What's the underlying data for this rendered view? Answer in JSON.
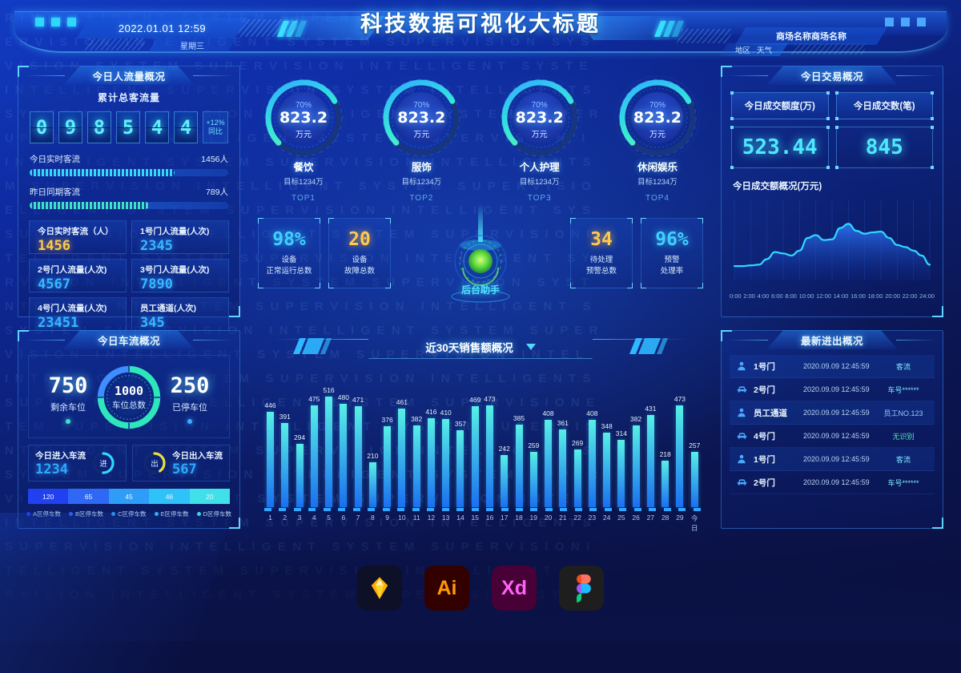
{
  "header": {
    "title": "科技数据可视化大标题",
    "datetime": "2022.01.01 12:59",
    "weekday": "星期三",
    "mall_name": "商场名称商场名称",
    "region_weather": "地区 . 天气"
  },
  "flow_panel": {
    "title": "今日人流量概况",
    "counter_label": "累计总客流量",
    "counter_digits": [
      "0",
      "9",
      "8",
      "5",
      "4",
      "4"
    ],
    "compare_value": "+12%",
    "compare_label": "同比",
    "bars": [
      {
        "label": "今日实时客流",
        "value": "1456人",
        "percent": 73,
        "color": "#35d6ff"
      },
      {
        "label": "昨日同期客流",
        "value": "789人",
        "percent": 60,
        "color": "#3fe0c8"
      }
    ],
    "cells": [
      {
        "label": "今日实时客流（人）",
        "value": "1456",
        "gold": true
      },
      {
        "label": "1号门人流量(人次)",
        "value": "2345",
        "gold": false
      },
      {
        "label": "2号门人流量(人次)",
        "value": "4567",
        "gold": false
      },
      {
        "label": "3号门人流量(人次)",
        "value": "7890",
        "gold": false
      },
      {
        "label": "4号门人流量(人次)",
        "value": "23451",
        "gold": false
      },
      {
        "label": "员工通道(人次)",
        "value": "345",
        "gold": false
      }
    ]
  },
  "parking_panel": {
    "title": "今日车流概况",
    "remaining_value": "750",
    "remaining_label": "剩余车位",
    "parked_value": "250",
    "parked_label": "已停车位",
    "total_value": "1000",
    "total_label": "车位总数",
    "in_label": "今日进入车流",
    "in_value": "1234",
    "in_badge": "进",
    "out_label": "今日出入车流",
    "out_value": "567",
    "out_badge": "出",
    "zones": [
      {
        "name": "A区停车数",
        "value": "120",
        "color": "#2140f0"
      },
      {
        "name": "B区停车数",
        "value": "65",
        "color": "#2f68f5"
      },
      {
        "name": "C区停车数",
        "value": "45",
        "color": "#2f9cf8"
      },
      {
        "name": "E区停车数",
        "value": "46",
        "color": "#2fc2f8"
      },
      {
        "name": "D区停车数",
        "value": "20",
        "color": "#3fe0e8"
      }
    ]
  },
  "gauges": [
    {
      "percent": "70%",
      "value": "823.2",
      "unit": "万元",
      "name": "餐饮",
      "target": "目标1234万",
      "rank": "TOP1",
      "ratio": 0.7
    },
    {
      "percent": "70%",
      "value": "823.2",
      "unit": "万元",
      "name": "服饰",
      "target": "目标1234万",
      "rank": "TOP2",
      "ratio": 0.7
    },
    {
      "percent": "70%",
      "value": "823.2",
      "unit": "万元",
      "name": "个人护理",
      "target": "目标1234万",
      "rank": "TOP3",
      "ratio": 0.7
    },
    {
      "percent": "70%",
      "value": "823.2",
      "unit": "万元",
      "name": "休闲娱乐",
      "target": "目标1234万",
      "rank": "TOP4",
      "ratio": 0.7
    }
  ],
  "kpis": [
    {
      "value": "98%",
      "line1": "设备",
      "line2": "正常运行总数",
      "gold": false
    },
    {
      "value": "20",
      "line1": "设备",
      "line2": "故障总数",
      "gold": true
    },
    {
      "value": "34",
      "line1": "待处理",
      "line2": "预警总数",
      "gold": true
    },
    {
      "value": "96%",
      "line1": "预警",
      "line2": "处理率",
      "gold": false
    }
  ],
  "assistant_label": "后台助手",
  "trade_panel": {
    "title": "今日交易概况",
    "amount_label": "今日成交额度(万)",
    "amount_value": "523.44",
    "count_label": "今日成交数(笔)",
    "count_value": "845",
    "line_title": "今日成交额概况(万元)"
  },
  "log_panel": {
    "title": "最新进出概况",
    "rows": [
      {
        "icon": "person-icon",
        "gate": "1号门",
        "time": "2020.09.09 12:45:59",
        "tag": "客流",
        "tag_style": "cyan"
      },
      {
        "icon": "car-icon",
        "gate": "2号门",
        "time": "2020.09.09 12:45:59",
        "tag": "车号******",
        "tag_style": "cyan"
      },
      {
        "icon": "person-icon",
        "gate": "员工通道",
        "time": "2020.09.09 12:45:59",
        "tag": "员工NO.123",
        "tag_style": "blue"
      },
      {
        "icon": "car-icon",
        "gate": "4号门",
        "time": "2020.09.09 12:45:59",
        "tag": "无识别",
        "tag_style": "green"
      },
      {
        "icon": "person-icon",
        "gate": "1号门",
        "time": "2020.09.09 12:45:59",
        "tag": "客流",
        "tag_style": "cyan"
      },
      {
        "icon": "car-icon",
        "gate": "2号门",
        "time": "2020.09.09 12:45:59",
        "tag": "车号******",
        "tag_style": "cyan"
      }
    ]
  },
  "apps": [
    {
      "name": "sketch-app-icon",
      "label": ""
    },
    {
      "name": "illustrator-app-icon",
      "label": "Ai"
    },
    {
      "name": "xd-app-icon",
      "label": "Xd"
    },
    {
      "name": "figma-app-icon",
      "label": ""
    }
  ],
  "chart_data": [
    {
      "type": "bar",
      "title": "近30天销售额概况",
      "xlabel": "",
      "ylabel": "",
      "ylim": [
        0,
        560
      ],
      "grid": false,
      "categories": [
        "1",
        "2",
        "3",
        "4",
        "5",
        "6",
        "7",
        "8",
        "9",
        "10",
        "11",
        "12",
        "13",
        "14",
        "15",
        "16",
        "17",
        "18",
        "19",
        "20",
        "21",
        "22",
        "23",
        "24",
        "25",
        "26",
        "27",
        "28",
        "29",
        "今日"
      ],
      "values": [
        446,
        391,
        294,
        475,
        516,
        480,
        471,
        210,
        376,
        461,
        382,
        416,
        410,
        357,
        469,
        473,
        242,
        385,
        259,
        408,
        361,
        269,
        408,
        348,
        314,
        382,
        431,
        218,
        473,
        257
      ]
    },
    {
      "type": "line",
      "title": "今日成交额概况(万元)",
      "xlabel": "",
      "ylabel": "",
      "ylim": [
        0,
        100
      ],
      "grid": true,
      "legend": "none",
      "categories": [
        "0:00",
        "2:00",
        "4:00",
        "6:00",
        "8:00",
        "10:00",
        "12:00",
        "14:00",
        "16:00",
        "18:00",
        "20:00",
        "22:00",
        "24:00"
      ],
      "x": [
        0,
        1,
        2,
        3,
        4,
        5,
        6,
        7,
        8,
        9,
        10,
        11,
        12,
        13,
        14,
        15,
        16,
        17,
        18,
        19,
        20,
        21,
        22,
        23,
        24
      ],
      "values": [
        18,
        18,
        19,
        20,
        28,
        38,
        36,
        33,
        40,
        58,
        62,
        55,
        56,
        72,
        78,
        68,
        64,
        66,
        67,
        58,
        48,
        45,
        40,
        33,
        20
      ]
    }
  ]
}
